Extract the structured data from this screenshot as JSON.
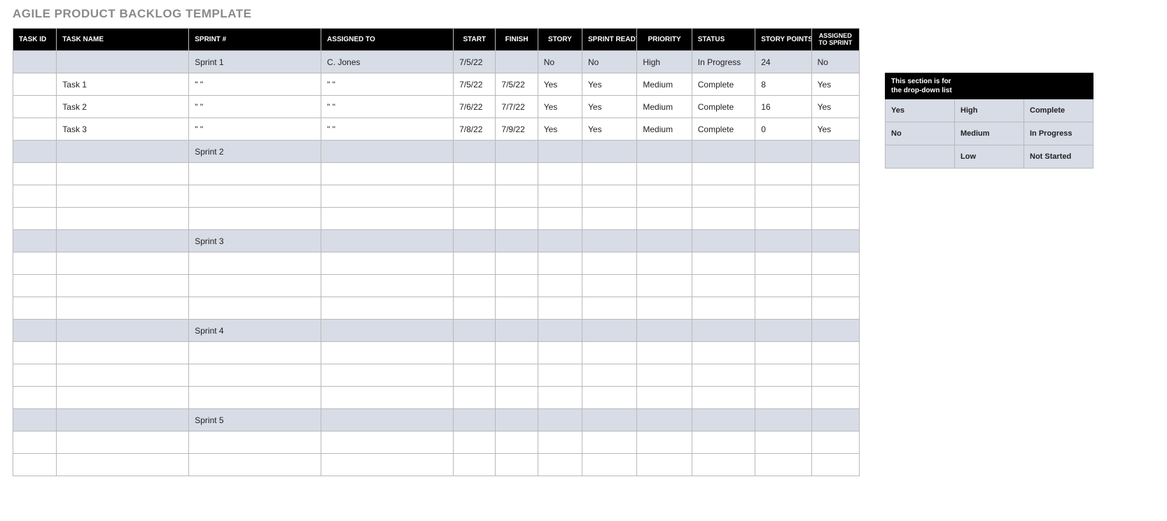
{
  "title": "AGILE PRODUCT BACKLOG TEMPLATE",
  "columns": {
    "task_id": "TASK ID",
    "task_name": "TASK NAME",
    "sprint": "SPRINT #",
    "assigned_to": "ASSIGNED TO",
    "start": "START",
    "finish": "FINISH",
    "story": "STORY",
    "sprint_ready": "SPRINT READY",
    "priority": "PRIORITY",
    "status": "STATUS",
    "story_points": "STORY POINTS",
    "assigned_to_sprint": "ASSIGNED TO SPRINT"
  },
  "rows": [
    {
      "type": "sprint",
      "task_id": "",
      "task_name": "",
      "sprint": "Sprint 1",
      "assigned_to": "C. Jones",
      "start": "7/5/22",
      "finish": "",
      "story": "No",
      "sprint_ready": "No",
      "priority": "High",
      "status": "In Progress",
      "story_points": "24",
      "assigned_to_sprint": "No"
    },
    {
      "type": "task",
      "task_id": "",
      "task_name": "Task 1",
      "sprint": "\" \"",
      "assigned_to": "\" \"",
      "start": "7/5/22",
      "finish": "7/5/22",
      "story": "Yes",
      "sprint_ready": "Yes",
      "priority": "Medium",
      "status": "Complete",
      "story_points": "8",
      "assigned_to_sprint": "Yes"
    },
    {
      "type": "task",
      "task_id": "",
      "task_name": "Task 2",
      "sprint": "\" \"",
      "assigned_to": "\" \"",
      "start": "7/6/22",
      "finish": "7/7/22",
      "story": "Yes",
      "sprint_ready": "Yes",
      "priority": "Medium",
      "status": "Complete",
      "story_points": "16",
      "assigned_to_sprint": "Yes"
    },
    {
      "type": "task",
      "task_id": "",
      "task_name": "Task 3",
      "sprint": "\" \"",
      "assigned_to": "\" \"",
      "start": "7/8/22",
      "finish": "7/9/22",
      "story": "Yes",
      "sprint_ready": "Yes",
      "priority": "Medium",
      "status": "Complete",
      "story_points": "0",
      "assigned_to_sprint": "Yes"
    },
    {
      "type": "sprint",
      "task_id": "",
      "task_name": "",
      "sprint": "Sprint 2",
      "assigned_to": "",
      "start": "",
      "finish": "",
      "story": "",
      "sprint_ready": "",
      "priority": "",
      "status": "",
      "story_points": "",
      "assigned_to_sprint": ""
    },
    {
      "type": "task"
    },
    {
      "type": "task"
    },
    {
      "type": "task"
    },
    {
      "type": "sprint",
      "task_id": "",
      "task_name": "",
      "sprint": "Sprint 3",
      "assigned_to": "",
      "start": "",
      "finish": "",
      "story": "",
      "sprint_ready": "",
      "priority": "",
      "status": "",
      "story_points": "",
      "assigned_to_sprint": ""
    },
    {
      "type": "task"
    },
    {
      "type": "task"
    },
    {
      "type": "task"
    },
    {
      "type": "sprint",
      "task_id": "",
      "task_name": "",
      "sprint": "Sprint 4",
      "assigned_to": "",
      "start": "",
      "finish": "",
      "story": "",
      "sprint_ready": "",
      "priority": "",
      "status": "",
      "story_points": "",
      "assigned_to_sprint": ""
    },
    {
      "type": "task"
    },
    {
      "type": "task"
    },
    {
      "type": "task"
    },
    {
      "type": "sprint",
      "task_id": "",
      "task_name": "",
      "sprint": "Sprint 5",
      "assigned_to": "",
      "start": "",
      "finish": "",
      "story": "",
      "sprint_ready": "",
      "priority": "",
      "status": "",
      "story_points": "",
      "assigned_to_sprint": ""
    },
    {
      "type": "task"
    },
    {
      "type": "task"
    }
  ],
  "dropdown": {
    "header": "This section is for\nthe drop-down list",
    "cells": [
      [
        "Yes",
        "High",
        "Complete"
      ],
      [
        "No",
        "Medium",
        "In Progress"
      ],
      [
        "",
        "Low",
        "Not Started"
      ]
    ]
  }
}
